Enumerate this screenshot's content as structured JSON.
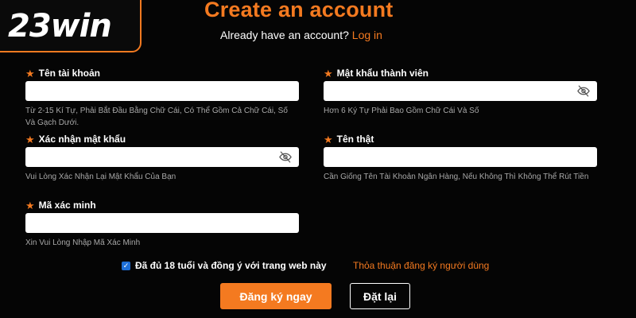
{
  "brand": {
    "logo_text": "23win",
    "accent_color": "#f47a20"
  },
  "header": {
    "title": "Create an account",
    "login_prompt": "Already have an account?",
    "login_link": "Log in"
  },
  "form": {
    "username": {
      "label": "Tên tài khoản",
      "value": "",
      "hint": "Từ 2-15 Kí Tự, Phải Bắt Đầu Bằng Chữ Cái, Có Thể Gồm Cả Chữ Cái, Số Và Gạch Dưới."
    },
    "password": {
      "label": "Mật khẩu thành viên",
      "value": "",
      "hint": "Hơn 6 Ký Tự Phải Bao Gồm Chữ Cái Và Số",
      "icon": "eye-slash-icon"
    },
    "confirm_password": {
      "label": "Xác nhận mật khẩu",
      "value": "",
      "hint": "Vui Lòng Xác Nhận Lại Mật Khẩu Của Bạn",
      "icon": "eye-slash-icon"
    },
    "real_name": {
      "label": "Tên thật",
      "value": "",
      "hint": "Cần Giống Tên Tài Khoản Ngân Hàng, Nếu Không Thì Không Thể Rút Tiền"
    },
    "verify_code": {
      "label": "Mã xác minh",
      "value": "",
      "hint": "Xin Vui Lòng Nhập Mã Xác Minh"
    }
  },
  "agreement": {
    "checked": true,
    "text": "Đã đủ 18 tuổi và đồng ý với trang web này",
    "terms_link": "Thỏa thuận đăng ký người dùng"
  },
  "buttons": {
    "register": "Đăng ký ngay",
    "reset": "Đặt lại"
  }
}
